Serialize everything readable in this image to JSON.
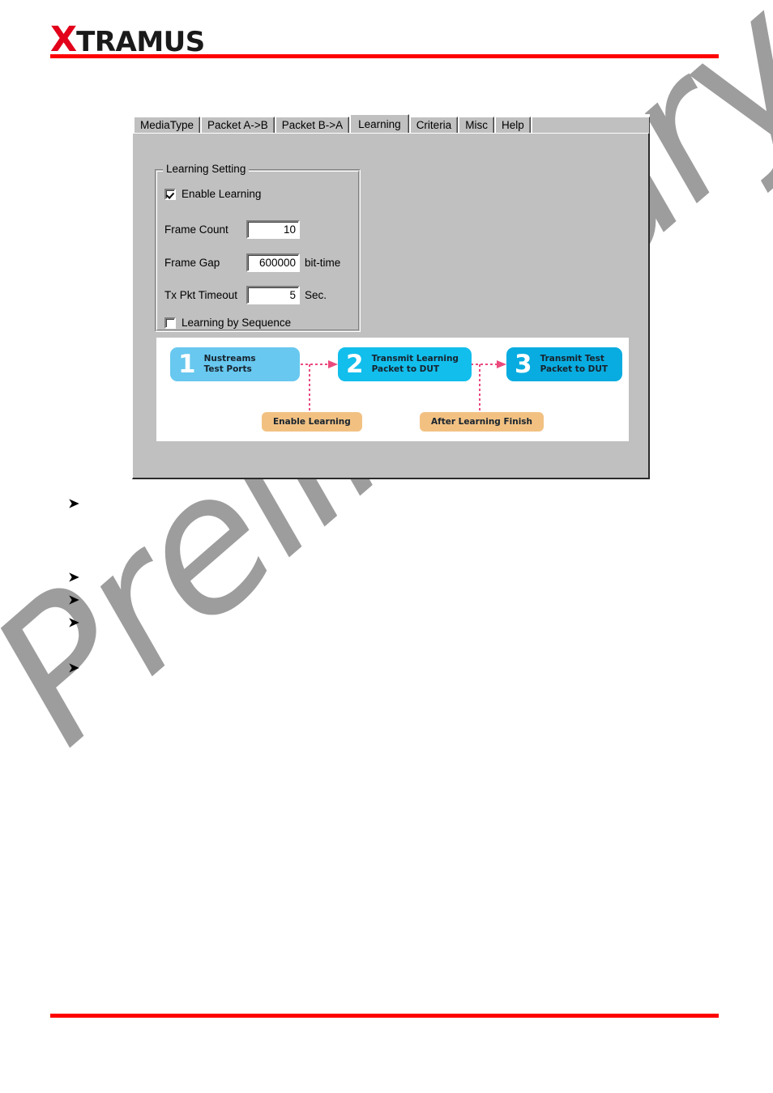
{
  "header": {
    "logo_x": "X",
    "logo_rest": "TRAMUS",
    "brand_color": "#e2001a",
    "rule_color": "#ff0000"
  },
  "watermark": {
    "text": "Preliminary",
    "color": "#9d9d9d"
  },
  "dialog": {
    "tabs": [
      {
        "label": "MediaType",
        "selected": false
      },
      {
        "label": "Packet A->B",
        "selected": false
      },
      {
        "label": "Packet B->A",
        "selected": false
      },
      {
        "label": "Learning",
        "selected": true
      },
      {
        "label": "Criteria",
        "selected": false
      },
      {
        "label": "Misc",
        "selected": false
      },
      {
        "label": "Help",
        "selected": false
      }
    ],
    "group": {
      "title": "Learning Setting",
      "enable_learning": {
        "label": "Enable Learning",
        "checked": true
      },
      "frame_count": {
        "label": "Frame Count",
        "value": "10",
        "unit": ""
      },
      "frame_gap": {
        "label": "Frame Gap",
        "value": "600000",
        "unit": "bit-time"
      },
      "tx_pkt_timeout": {
        "label": "Tx Pkt Timeout",
        "value": "5",
        "unit": "Sec."
      },
      "learning_by_sequence": {
        "label": "Learning by Sequence",
        "checked": false
      }
    },
    "diagram": {
      "steps": [
        {
          "number": "1",
          "line1": "Nustreams",
          "line2": "Test Ports",
          "color": "#68c8ef"
        },
        {
          "number": "2",
          "line1": "Transmit Learning",
          "line2": "Packet to DUT",
          "color": "#12beec"
        },
        {
          "number": "3",
          "line1": "Transmit Test",
          "line2": "Packet to DUT",
          "color": "#09ace0"
        }
      ],
      "callouts": [
        {
          "label": "Enable Learning",
          "color": "#f2c182"
        },
        {
          "label": "After Learning Finish",
          "color": "#f2c182"
        }
      ],
      "connector_color": "#eb4a7d"
    }
  },
  "body_bullets": [
    {
      "marker": "arrow",
      "text": ""
    },
    {
      "marker": "arrow",
      "text": ""
    },
    {
      "marker": "arrow",
      "text": ""
    },
    {
      "marker": "arrow",
      "text": ""
    },
    {
      "marker": "arrow",
      "text": ""
    }
  ]
}
